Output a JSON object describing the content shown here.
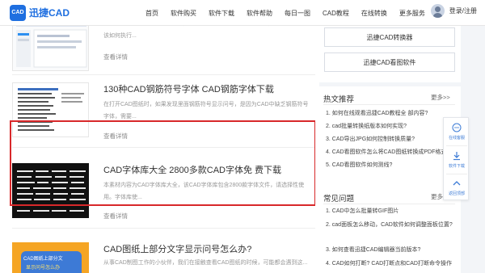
{
  "header": {
    "logo_mark": "CAD",
    "logo_text": "迅捷CAD",
    "nav": [
      "首页",
      "软件购买",
      "软件下载",
      "软件帮助",
      "每日一图",
      "CAD教程",
      "在线转换",
      "更多服务"
    ],
    "user_label": "登录/注册"
  },
  "articles": [
    {
      "title": "",
      "desc": "...当我们在打开CAD图纸的时候，可以使用迅捷CAD中的文字查找，然后进行操作该如何执行...",
      "more": "查看详情"
    },
    {
      "title": "130种CAD钢筋符号字体 CAD钢筋字体下载",
      "desc": "在打开CAD图纸时，如果发现里面钢筋符号显示问号，是因为CAD中缺乏钢筋符号字体，需要...",
      "more": "查看详情"
    },
    {
      "title": "CAD字体库大全 2800多款CAD字体免 费下载",
      "desc": "本素材内容为CAD字体库大全，该CAD字体库包含2800款字体文件，请选择性使用。字体库使...",
      "more": "查看详情"
    },
    {
      "title": "CAD图纸上部分文字显示问号怎么办?",
      "desc": "从事CAD制图工作的小伙伴，我们在接触查看CAD图纸的时候，可能都会遇到这...",
      "thumb_text_1": "CAD图纸上部分文",
      "thumb_text_2": "显示问号怎么办"
    }
  ],
  "sidebar": {
    "buttons": [
      "迅捷CAD转换器",
      "迅捷CAD看图软件"
    ],
    "hot": {
      "title": "热文推荐",
      "more": "更多>>",
      "items": [
        "1. 如何在线观看迅捷CAD教程全 部内容?",
        "2. cad批量转换纸版本如何实现?",
        "3. CAD导出JPG如何控制转换质量?",
        "4. CAD看图软件怎么将CAD图纸转换成PDF格式",
        "5. CAD看图软件如何测线?"
      ]
    },
    "faq": {
      "title": "常见问题",
      "more": "更多>>",
      "items": [
        "1. CAD中怎么批量转GIF图片",
        "2. cad面板怎么移动，CAD软件如何调整面板位置?",
        "3. 如何查看迅捷CAD编辑器当前版本?",
        "4. CAD如何打断? CAD打断点和CAD打断命令操作"
      ]
    }
  },
  "float_widget": {
    "items": [
      {
        "icon": "chat-icon",
        "label": "在线客服"
      },
      {
        "icon": "download-icon",
        "label": "软件下载"
      },
      {
        "icon": "arrow-up-icon",
        "label": "返回顶部"
      }
    ]
  },
  "colors": {
    "brand": "#1f6fe0",
    "highlight": "#d8282a",
    "link": "#3c7bd6"
  }
}
